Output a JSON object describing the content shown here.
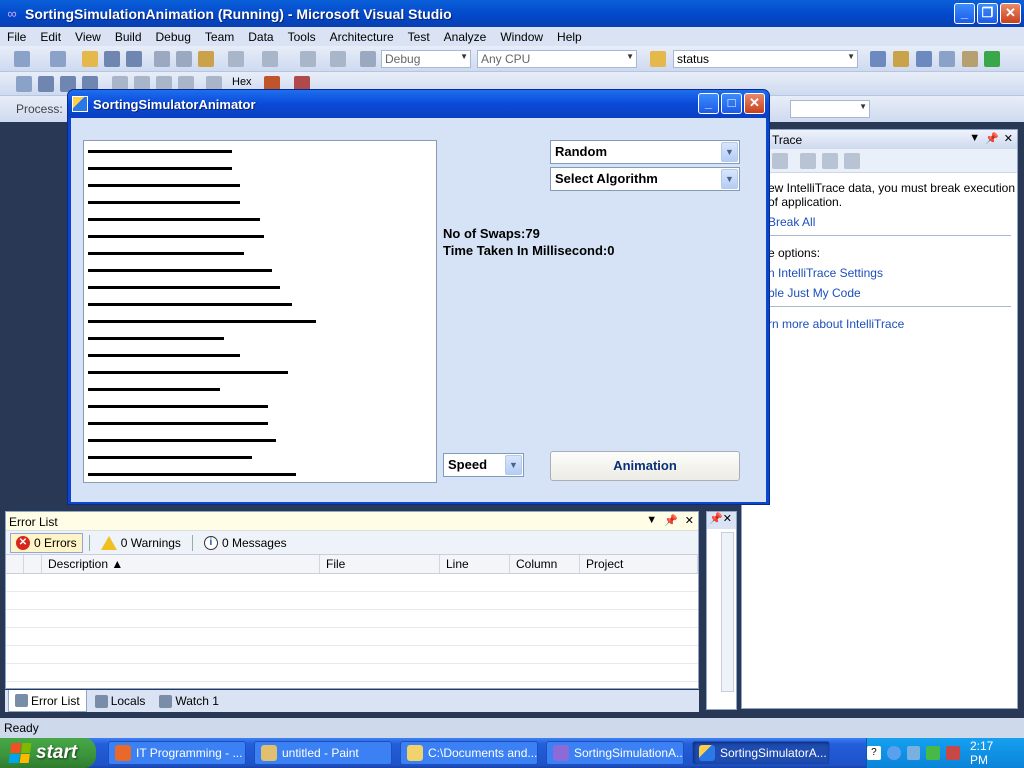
{
  "vs": {
    "title": "SortingSimulationAnimation (Running) - Microsoft Visual Studio",
    "menu": [
      "File",
      "Edit",
      "View",
      "Build",
      "Debug",
      "Team",
      "Data",
      "Tools",
      "Architecture",
      "Test",
      "Analyze",
      "Window",
      "Help"
    ],
    "toolbar": {
      "config": "Debug",
      "platform": "Any CPU",
      "find": "status",
      "hex_label": "Hex",
      "process_label": "Process:"
    },
    "status": "Ready"
  },
  "intellitrace": {
    "title": "Trace",
    "message": "ew IntelliTrace data, you must break execution of application.",
    "break_all": "Break All",
    "options_label": "e options:",
    "settings_link": "n IntelliTrace Settings",
    "just_my_code": "ble Just My Code",
    "learn_more": "rn more about IntelliTrace"
  },
  "error_list": {
    "title": "Error List",
    "errors": "0 Errors",
    "warnings": "0 Warnings",
    "messages": "0 Messages",
    "columns": [
      "Description",
      "File",
      "Line",
      "Column",
      "Project"
    ],
    "tabs": [
      "Error List",
      "Locals",
      "Watch 1"
    ]
  },
  "simulator": {
    "title": "SortingSimulatorAnimator",
    "order_dropdown": "Random",
    "algorithm_dropdown": "Select Algorithm",
    "swaps": "No of Swaps:79",
    "time": "Time Taken In Millisecond:0",
    "speed_dropdown": "Speed",
    "animation_button": "Animation",
    "bar_values": [
      144,
      144,
      152,
      152,
      172,
      176,
      156,
      184,
      192,
      204,
      228,
      136,
      152,
      200,
      132,
      180,
      180,
      188,
      164,
      208
    ]
  },
  "taskbar": {
    "start": "start",
    "tasks": [
      "IT Programming - ...",
      "untitled - Paint",
      "C:\\Documents and...",
      "SortingSimulationA...",
      "SortingSimulatorA..."
    ],
    "clock": "2:17 PM"
  },
  "colors": {
    "vs_titlebar": "#0247c9",
    "sim_client": "#d6e3f6",
    "taskbar": "#245edb",
    "start_green": "#3b933b"
  }
}
